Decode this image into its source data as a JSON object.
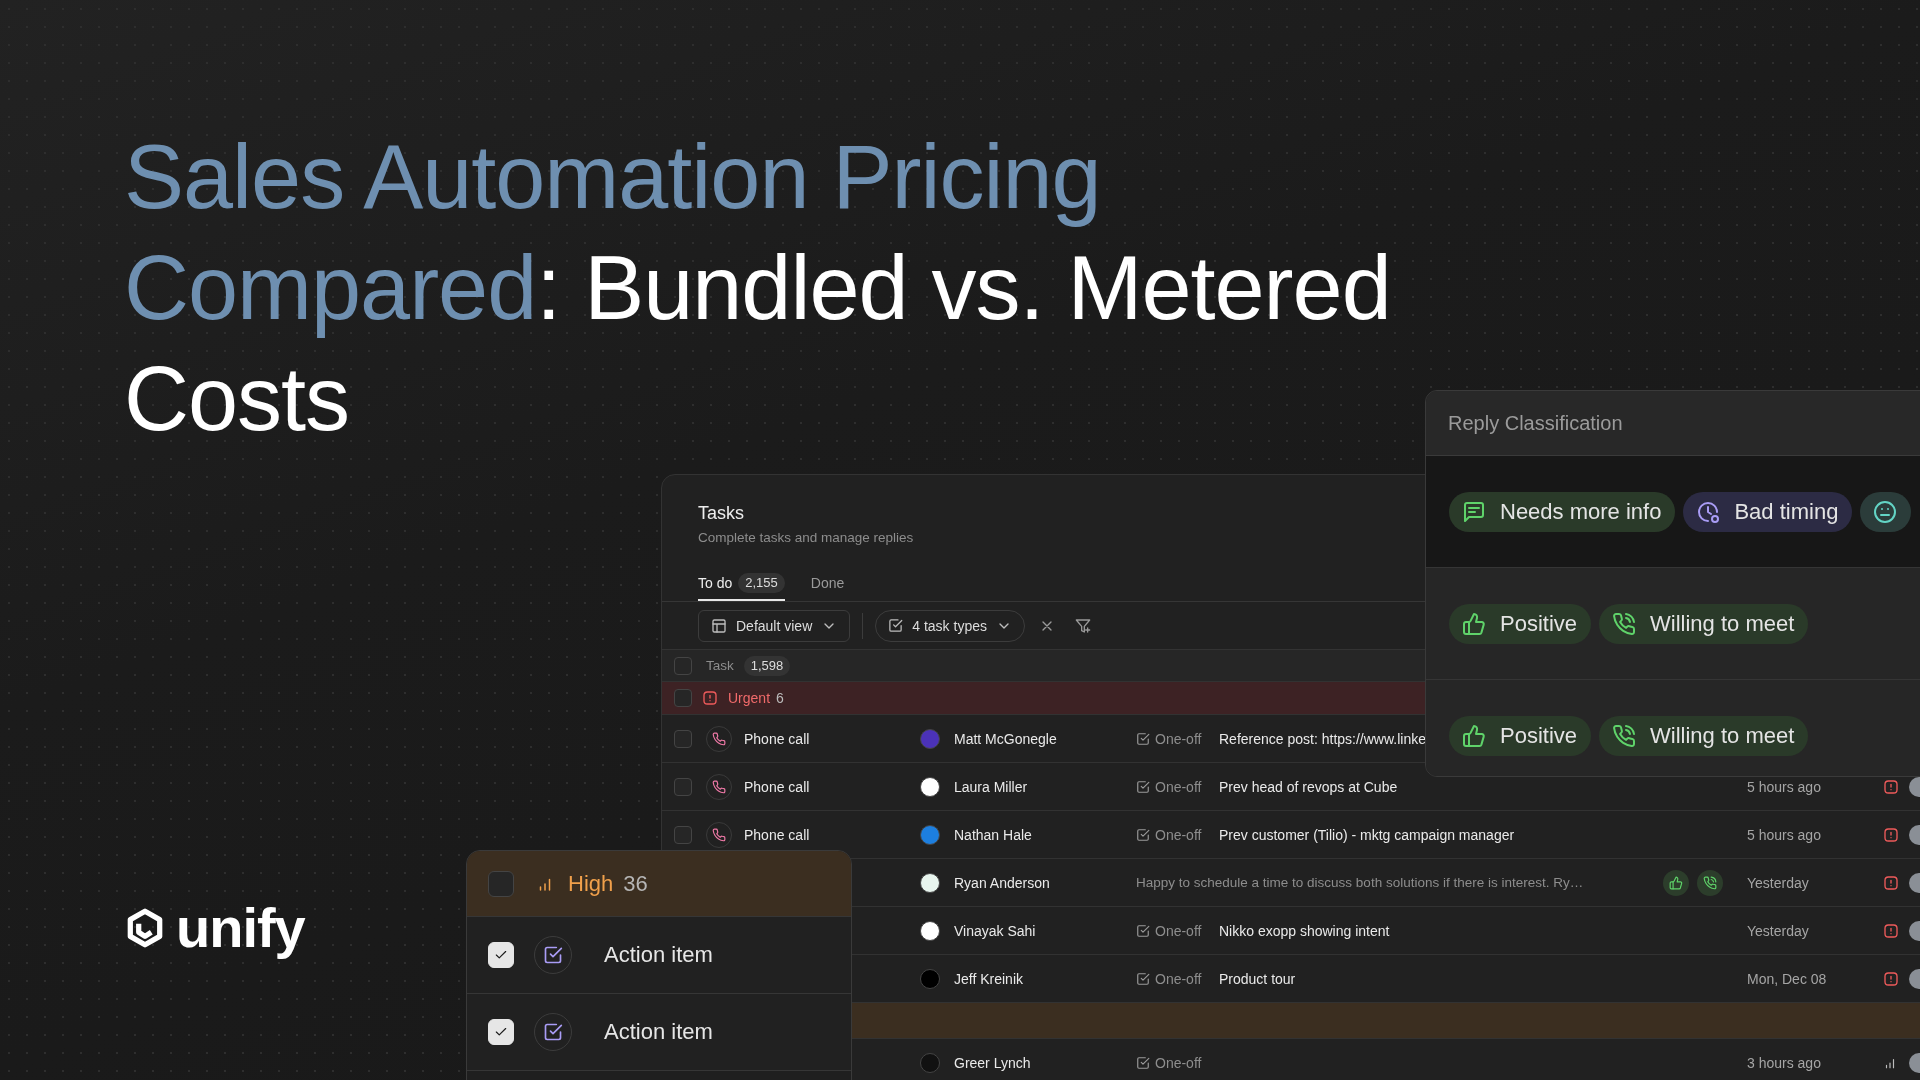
{
  "heading": {
    "accent": "Sales Automation Pricing Compared",
    "text": ": Bundled vs. Metered Costs"
  },
  "logo": {
    "text": "unify"
  },
  "tasks_panel": {
    "title": "Tasks",
    "subtitle": "Complete tasks and manage replies",
    "tabs": [
      {
        "label": "To do",
        "count": "2,155",
        "selected": true
      },
      {
        "label": "Done",
        "selected": false
      }
    ],
    "toolbar": {
      "view": "Default view",
      "filter": "4 task types"
    },
    "header": {
      "label": "Task",
      "count": "1,598",
      "checked": false
    },
    "rows": [
      {
        "kind": "group",
        "color": "#3d2224",
        "label": "Urgent",
        "count": "6",
        "checked": false
      },
      {
        "kind": "task",
        "checked": false,
        "type": "Phone call",
        "contact": "Matt McGonegle",
        "color": "#4b32b8",
        "tag": "One-off",
        "description": "Reference post: https://www.linke"
      },
      {
        "kind": "task",
        "checked": false,
        "type": "Phone call",
        "contact": "Laura Miller",
        "color": "#ffffff",
        "tag": "One-off",
        "description": "Prev head of revops at Cube",
        "time": "5 hours ago",
        "urgent": true
      },
      {
        "kind": "task",
        "checked": false,
        "type": "Phone call",
        "contact": "Nathan Hale",
        "color": "#1d7fe0",
        "tag": "One-off",
        "description": "Prev customer (Tilio) - mktg campaign manager",
        "time": "5 hours ago",
        "urgent": true
      },
      {
        "kind": "reply",
        "contact": "Ryan Anderson",
        "color": "#e8f5ee",
        "message": "Happy to schedule a time to discuss both solutions if there is interest. Ry…",
        "reactions": [
          {
            "kind": "positive"
          },
          {
            "kind": "meeting"
          }
        ],
        "time": "Yesterday",
        "urgent": true
      },
      {
        "kind": "task",
        "contact": "Vinayak Sahi",
        "color": "#ffffff",
        "tag": "One-off",
        "description": "Nikko exopp showing intent",
        "time": "Yesterday",
        "urgent": true
      },
      {
        "kind": "task",
        "contact": "Jeff Kreinik",
        "color": "#000000",
        "tag": "One-off",
        "description": "Product tour",
        "time": "Mon, Dec 08",
        "urgent": true
      },
      {
        "kind": "band",
        "color": "#3b2e20"
      },
      {
        "kind": "task",
        "contact": "Greer Lynch",
        "color": "#111111",
        "tag": "One-off",
        "time": "3 hours ago",
        "urgent": false
      }
    ]
  },
  "reply_panel": {
    "title": "Reply Classification",
    "rows": [
      {
        "dark": true,
        "chips": [
          {
            "kind": "needs_info",
            "label": "Needs more info"
          },
          {
            "kind": "bad_timing",
            "label": "Bad timing"
          },
          {
            "kind": "neutral"
          }
        ]
      },
      {
        "dark": false,
        "chips": [
          {
            "kind": "positive",
            "label": "Positive"
          },
          {
            "kind": "meeting",
            "label": "Willing to meet"
          }
        ]
      },
      {
        "dark": false,
        "chips": [
          {
            "kind": "positive",
            "label": "Positive"
          },
          {
            "kind": "meeting",
            "label": "Willing to meet"
          }
        ]
      }
    ]
  },
  "priority_panel": {
    "header": {
      "color": "#3b2e20",
      "label": "High",
      "count": "36",
      "checked": false
    },
    "items": [
      {
        "checked": true,
        "label": "Action item"
      },
      {
        "checked": true,
        "label": "Action item"
      },
      {
        "empty": true
      }
    ]
  }
}
